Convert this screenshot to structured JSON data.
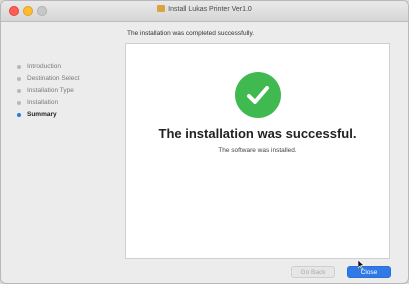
{
  "window": {
    "title": "Install Lukas Printer Ver1.0"
  },
  "subheader": "The installation was completed successfully.",
  "sidebar": {
    "items": [
      {
        "label": "Introduction",
        "active": false
      },
      {
        "label": "Destination Select",
        "active": false
      },
      {
        "label": "Installation Type",
        "active": false
      },
      {
        "label": "Installation",
        "active": false
      },
      {
        "label": "Summary",
        "active": true
      }
    ]
  },
  "main": {
    "headline": "The installation was successful.",
    "message": "The software was installed."
  },
  "buttons": {
    "back_label": "Go Back",
    "close_label": "Close"
  },
  "colors": {
    "accent": "#2f7ae5",
    "success": "#3fb950"
  }
}
